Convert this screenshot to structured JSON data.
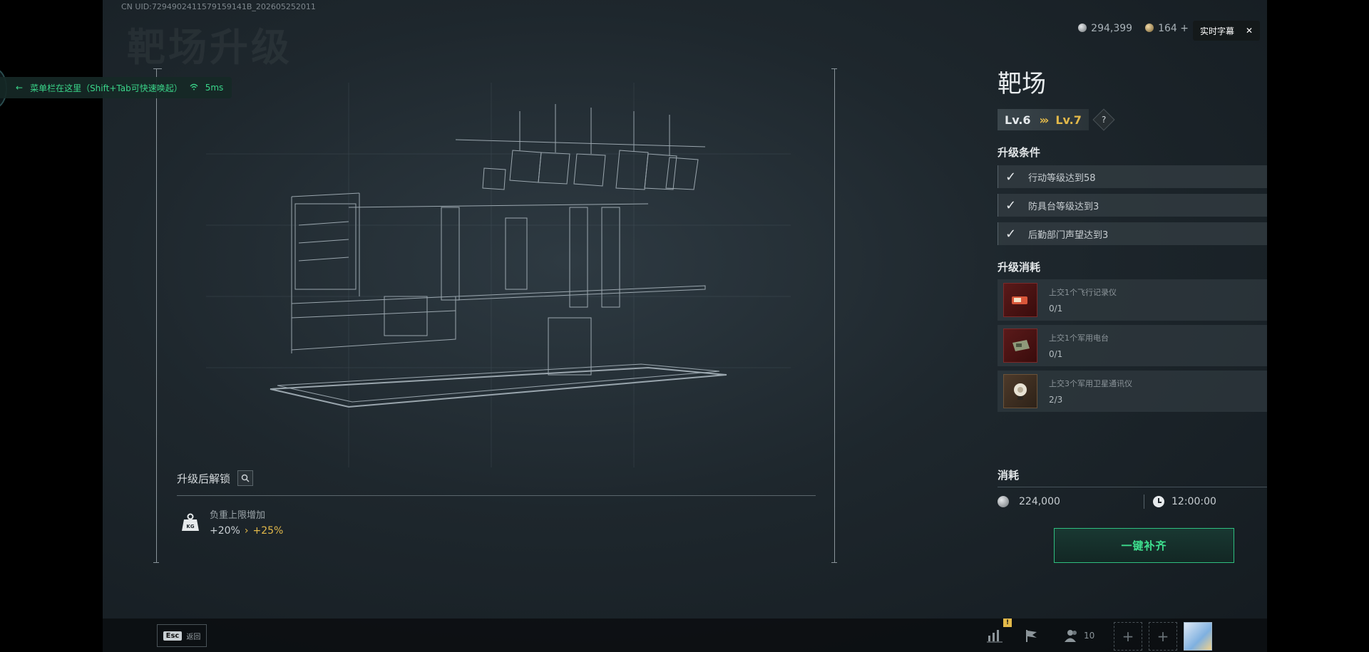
{
  "uid": "CN UID:7294902411579159141B_202605252011",
  "watermark": "靶场升级",
  "toast": {
    "text": "菜单栏在这里（Shift+Tab可快速唤起）",
    "ping": "5ms"
  },
  "currency": {
    "silver": "294,399",
    "gold": "164",
    "plus": "+"
  },
  "caption": {
    "label": "实时字幕",
    "close": "✕"
  },
  "viewer": {
    "unlock_title": "升级后解锁",
    "unlock_item": {
      "label": "负重上限增加",
      "from": "+20%",
      "to": "+25%",
      "arrow": "›",
      "icon_text": "KG"
    }
  },
  "facility": {
    "title": "靶场",
    "level_current": "Lv.6",
    "level_arrows": "›››",
    "level_next": "Lv.7",
    "help": "?",
    "conditions_title": "升级条件",
    "conditions": [
      {
        "label": "行动等级达到58"
      },
      {
        "label": "防具台等级达到3"
      },
      {
        "label": "后勤部门声望达到3"
      }
    ],
    "cost_title": "升级消耗",
    "materials": [
      {
        "name": "上交1个飞行记录仪",
        "count": "0/1"
      },
      {
        "name": "上交1个军用电台",
        "count": "0/1"
      },
      {
        "name": "上交3个军用卫星通讯仪",
        "count": "2/3"
      }
    ]
  },
  "consume": {
    "title": "消耗",
    "money": "224,000",
    "time": "12:00:00"
  },
  "fill_button": "一键补齐",
  "bottombar": {
    "esc_key": "Esc",
    "esc_label": "返回",
    "badge": "!",
    "friends": "10",
    "slot_plus": "+"
  },
  "colors": {
    "accent_green": "#3ee08f",
    "accent_gold": "#e3b94a"
  }
}
